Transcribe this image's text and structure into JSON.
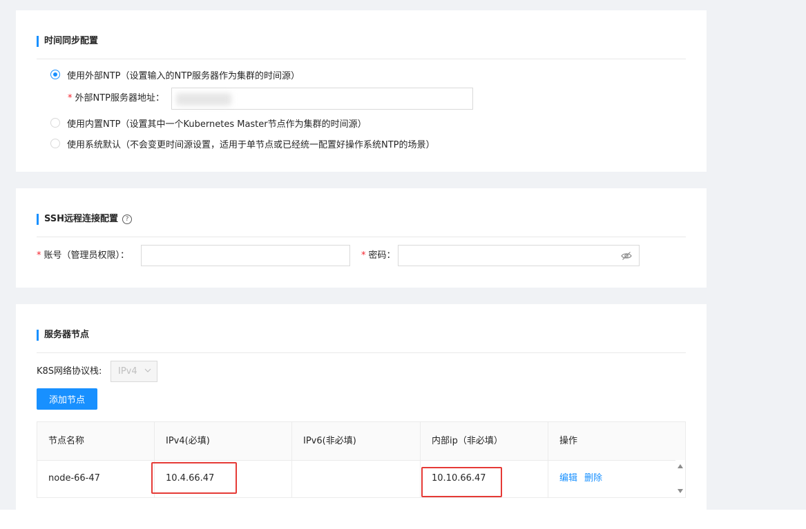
{
  "ntp_section": {
    "title": "时间同步配置",
    "options": [
      {
        "label": "使用外部NTP（设置输入的NTP服务器作为集群的时间源）",
        "checked": true
      },
      {
        "label": "使用内置NTP（设置其中一个Kubernetes Master节点作为集群的时间源）",
        "checked": false
      },
      {
        "label": "使用系统默认（不会变更时间源设置，适用于单节点或已经统一配置好操作系统NTP的场景）",
        "checked": false
      }
    ],
    "server_field": {
      "required_mark": "*",
      "label": "外部NTP服务器地址：",
      "value": ""
    }
  },
  "ssh_section": {
    "title": "SSH远程连接配置",
    "help_glyph": "?",
    "account": {
      "required_mark": "*",
      "label": "账号（管理员权限）：",
      "value": ""
    },
    "password": {
      "required_mark": "*",
      "label": "密码：",
      "value": ""
    }
  },
  "nodes_section": {
    "title": "服务器节点",
    "stack_label": "K8S网络协议栈:",
    "stack_value": "IPv4",
    "add_button": "添加节点",
    "table": {
      "headers": [
        "节点名称",
        "IPv4(必填)",
        "IPv6(非必填)",
        "内部ip（非必填）",
        "操作"
      ],
      "rows": [
        {
          "name": "node-66-47",
          "ipv4": "10.4.66.47",
          "ipv6": "",
          "internal_ip": "10.10.66.47",
          "actions": [
            "编辑",
            "删除"
          ]
        }
      ]
    }
  },
  "colors": {
    "accent": "#1890ff",
    "required": "#f5222d",
    "highlight_box": "#e53935",
    "background": "#f0f2f5"
  },
  "icons": {
    "help": "question-circle-icon",
    "eye": "eye-invisible-icon",
    "select_arrow": "chevron-down-icon"
  }
}
